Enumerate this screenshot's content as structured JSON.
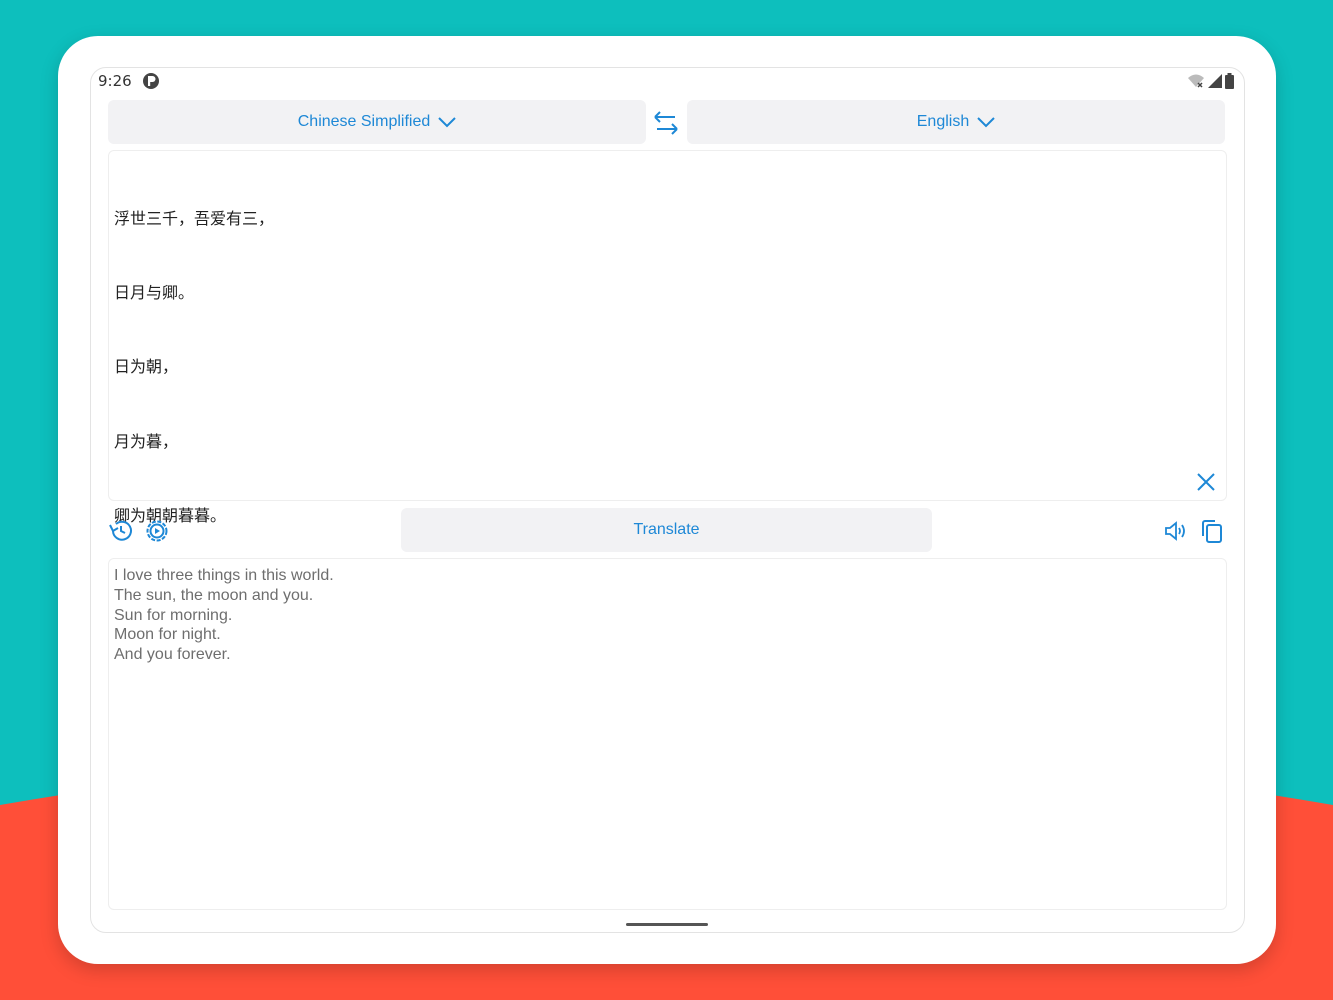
{
  "status_bar": {
    "time": "9:26",
    "icons": [
      "app-indicator-icon",
      "wifi-off-icon",
      "signal-icon",
      "battery-icon"
    ]
  },
  "languages": {
    "source": "Chinese Simplified",
    "target": "English"
  },
  "input": {
    "lines": [
      "浮世三千，吾爱有三，",
      "日月与卿。",
      "日为朝，",
      "月为暮，",
      "卿为朝朝暮暮。"
    ]
  },
  "actions": {
    "translate_label": "Translate"
  },
  "output": {
    "lines": [
      "I love three things in this world.",
      "The sun, the moon and you.",
      "Sun for morning.",
      "Moon for night.",
      "And you forever."
    ]
  },
  "colors": {
    "accent": "#1e88d6",
    "background_top": "#0dbfbd",
    "background_bottom": "#ff4f38",
    "button_bg": "#f2f2f4"
  }
}
